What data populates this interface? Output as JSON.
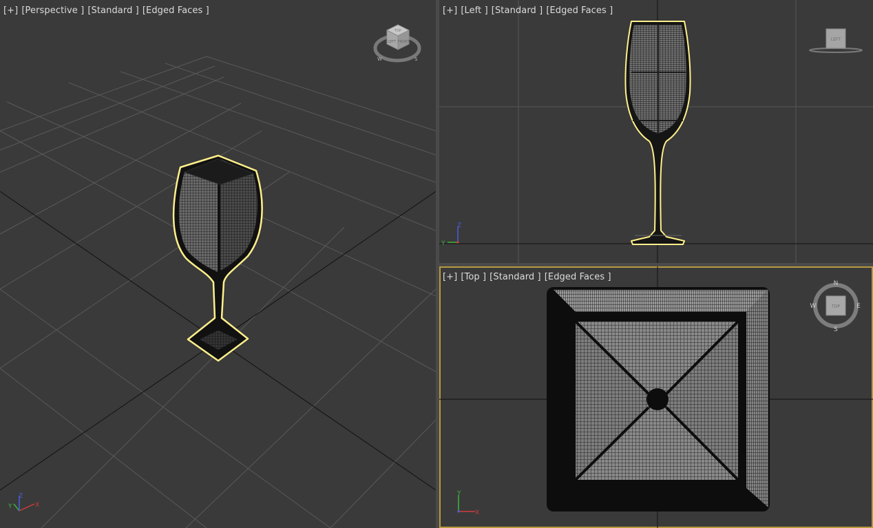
{
  "viewports": {
    "perspective": {
      "menu_plus": "[+]",
      "view_name": "[Perspective ]",
      "shading": "[Standard ]",
      "display": "[Edged Faces ]",
      "cube_face_top": "TOP",
      "cube_face_left": "LEFT",
      "cube_face_front": "FRONT",
      "compass_w": "W",
      "compass_s": "S"
    },
    "left": {
      "menu_plus": "[+]",
      "view_name": "[Left ]",
      "shading": "[Standard ]",
      "display": "[Edged Faces ]",
      "cube_face": "LEFT"
    },
    "top": {
      "menu_plus": "[+]",
      "view_name": "[Top ]",
      "shading": "[Standard ]",
      "display": "[Edged Faces ]",
      "cube_face": "TOP",
      "compass_n": "N",
      "compass_e": "E",
      "compass_s": "S",
      "compass_w": "W"
    }
  },
  "axes": {
    "x": "X",
    "y": "Y",
    "z": "Z"
  },
  "colors": {
    "viewport_bg": "#3a3a3a",
    "grid_line": "#575757",
    "grid_main": "#141414",
    "selection_outline": "#fff08a",
    "active_border": "#b69a3c",
    "axis_x": "#d23c3c",
    "axis_y": "#3cb43c",
    "axis_z": "#4a5ee0"
  }
}
